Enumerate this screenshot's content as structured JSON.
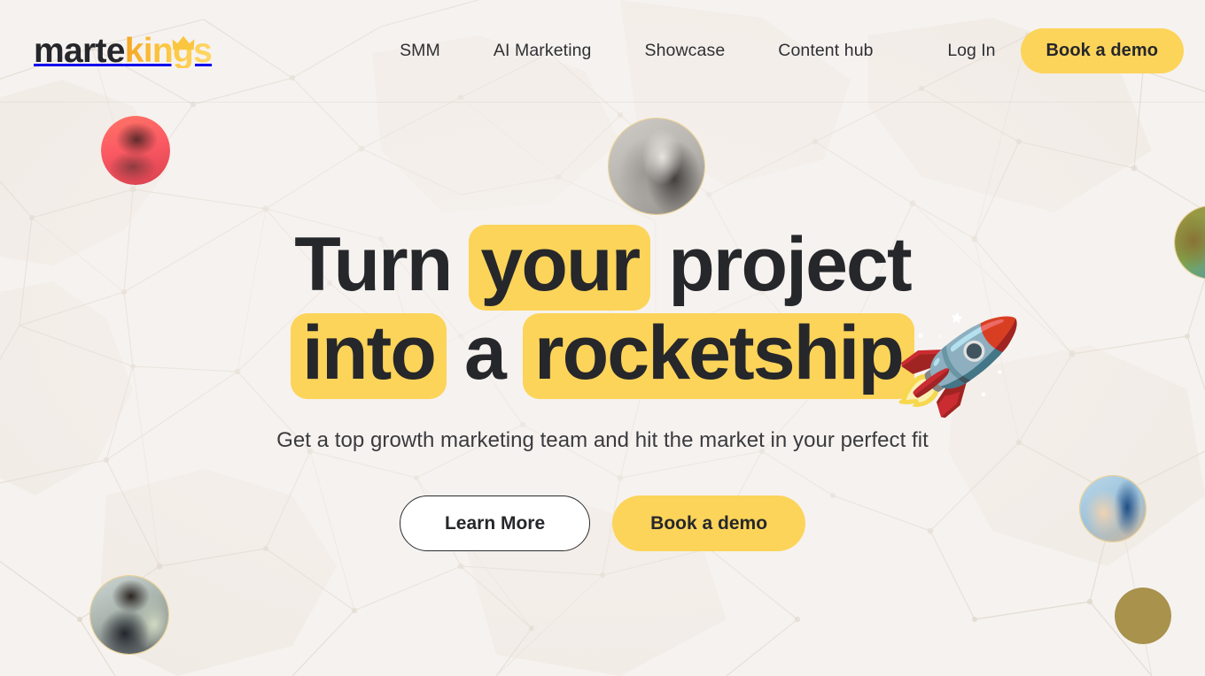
{
  "brand": {
    "logo_primary": "marte",
    "logo_accent": "kings",
    "crown_icon": "crown-icon"
  },
  "header": {
    "nav": [
      {
        "label": "SMM",
        "name": "nav-link-smm"
      },
      {
        "label": "AI Marketing",
        "name": "nav-link-ai-marketing"
      },
      {
        "label": "Showcase",
        "name": "nav-link-showcase"
      },
      {
        "label": "Content hub",
        "name": "nav-link-content-hub"
      }
    ],
    "login_label": "Log In",
    "demo_button_label": "Book a demo"
  },
  "hero": {
    "headline": {
      "line1": [
        {
          "text": "Turn",
          "highlight": false
        },
        {
          "text": "your",
          "highlight": true
        },
        {
          "text": "project",
          "highlight": false
        }
      ],
      "line2": [
        {
          "text": "into",
          "highlight": true
        },
        {
          "text": "a",
          "highlight": false
        },
        {
          "text": "rocketship",
          "highlight": true
        }
      ],
      "line1_plain": "Turn your project",
      "line2_plain": "into a rocketship",
      "word_turn": "Turn",
      "word_your": "your",
      "word_project": "project",
      "word_into": "into",
      "word_a": "a",
      "word_rocketship": "rocketship"
    },
    "rocket_icon": "🚀",
    "subtitle": "Get a top growth marketing team and hit the market in your perfect fit",
    "cta_primary_label": "Learn More",
    "cta_secondary_label": "Book a demo"
  },
  "avatars": [
    {
      "name": "avatar-top-left",
      "description": "portrait with warm red tint"
    },
    {
      "name": "avatar-top-center",
      "description": "grayscale portrait of a woman"
    },
    {
      "name": "avatar-right-edge",
      "description": "portrait cropped at right edge"
    },
    {
      "name": "avatar-mid-right",
      "description": "portrait with blue sky background"
    },
    {
      "name": "avatar-bottom-left",
      "description": "portrait of a man in dark jacket"
    },
    {
      "name": "avatar-bottom-right",
      "description": "solid olive circle placeholder"
    }
  ],
  "colors": {
    "background": "#f6f2ef",
    "text": "#26272b",
    "accent_yellow": "#fcd45a",
    "logo_orange": "#f5a623",
    "mesh": "#e3dbd2",
    "olive_circle": "#a8924c"
  }
}
